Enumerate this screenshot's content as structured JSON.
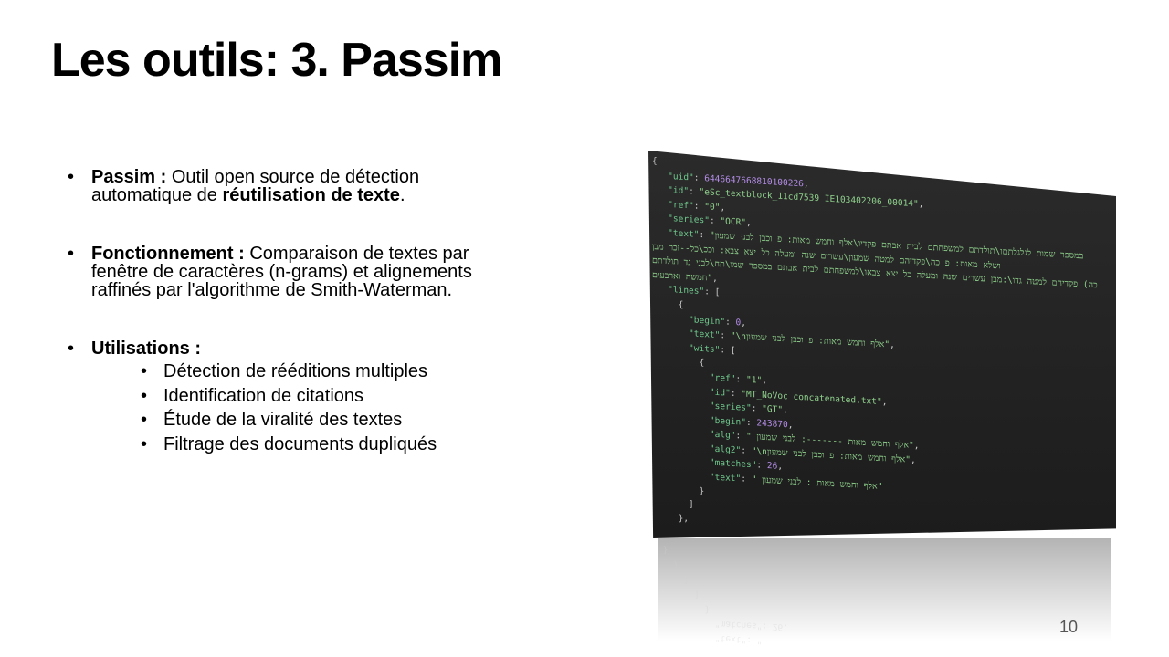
{
  "slide": {
    "title": "Les outils: 3.  Passim",
    "page_number": "10",
    "bullets": [
      {
        "label": "Passim :",
        "text_pre": " Outil open source de détection automatique de ",
        "bold": "réutilisation de texte",
        "text_post": "."
      },
      {
        "label": "Fonctionnement :",
        "text": " Comparaison de textes par fenêtre de caractères (n-grams) et alignements raffinés par l'algorithme de Smith-Waterman."
      },
      {
        "label": "Utilisations :",
        "items": [
          "Détection de rééditions multiples",
          "Identification de citations",
          "Étude de la viralité des textes",
          "Filtrage des documents dupliqués"
        ]
      }
    ]
  },
  "code": {
    "uid": "6446647668810100226",
    "id": "eSc_textblock_11cd7539_IE103402206_00014",
    "ref": "0",
    "series": "OCR",
    "text_line1": "במספר שמות לגלגלתםו\\תולדתם למשפחתם לבית אבתם פקדיו\\אלף וחמש מאות: פ וכבן לבני שמעון",
    "text_line2": "ושלא מאות: פ כה\\פקדיהם למטה שמעון\\עשרים שנה ומעלה כל יצא צבא: וככ\\כל--זכר מבן",
    "text_line3": "כה) פקדיהם למטה גדו\\:מבן עשרים שנה ומעלה כל יצא צבאו\\למשפחתם לבית אבתם במספר שמו\\תח\\לבני גד תולדתם",
    "text_line4": "חמשה וארבעים",
    "line_begin": "0",
    "line_text": "\\nאלף וחמש מאות: פ וכבן לבני שמעון",
    "wit_ref": "1",
    "wit_id": "MT_NoVoc_concatenated.txt",
    "wit_series": "GT",
    "wit_begin": "243870",
    "wit_alg": " אלף וחמש מאות -------: לבני שמעון",
    "wit_alg2": "\\nאלף וחמש מאות: פ וכבן לבני שמעון",
    "wit_matches": "26",
    "wit_text": " אלף וחמש מאות : לבני שמעון"
  }
}
